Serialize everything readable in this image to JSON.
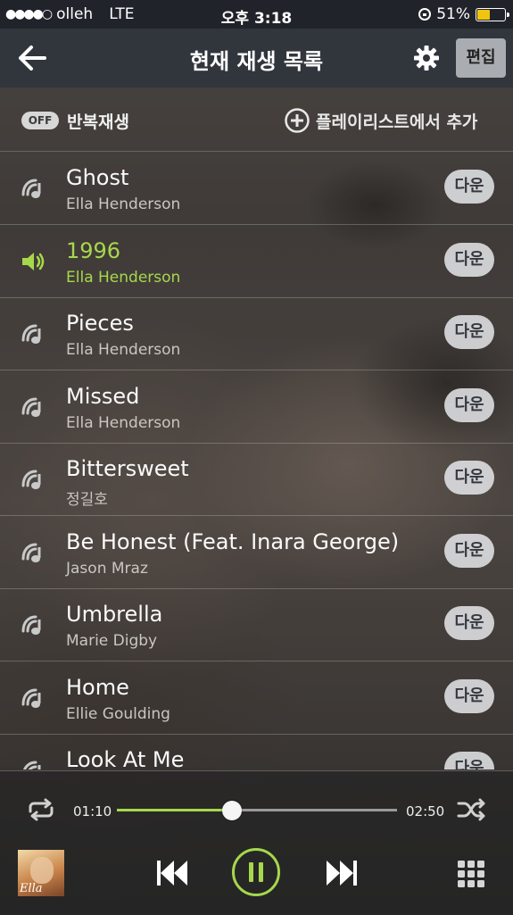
{
  "status_bar": {
    "carrier": "olleh",
    "network": "LTE",
    "time": "오후 3:18",
    "battery_text": "51%",
    "battery_level": 0.51
  },
  "nav": {
    "title": "현재 재생 목록",
    "edit_label": "편집"
  },
  "options": {
    "repeat_state": "OFF",
    "repeat_label": "반복재생",
    "add_label": "플레이리스트에서 추가"
  },
  "download_label": "다운",
  "tracks": [
    {
      "title": "Ghost",
      "artist": "Ella Henderson",
      "playing": false
    },
    {
      "title": "1996",
      "artist": "Ella Henderson",
      "playing": true
    },
    {
      "title": "Pieces",
      "artist": "Ella Henderson",
      "playing": false
    },
    {
      "title": "Missed",
      "artist": "Ella Henderson",
      "playing": false
    },
    {
      "title": "Bittersweet",
      "artist": "정길호",
      "playing": false
    },
    {
      "title": "Be Honest (Feat. Inara George)",
      "artist": "Jason Mraz",
      "playing": false
    },
    {
      "title": "Umbrella",
      "artist": "Marie Digby",
      "playing": false
    },
    {
      "title": "Home",
      "artist": "Ellie Goulding",
      "playing": false
    },
    {
      "title": "Look At Me",
      "artist": "",
      "playing": false
    }
  ],
  "player": {
    "current_time": "01:10",
    "total_time": "02:50",
    "progress": 0.41,
    "album_art_text": "Ella"
  },
  "colors": {
    "accent": "#a6d84b",
    "nav_bg": "#30343c",
    "status_bg": "#20232a"
  },
  "icons": {
    "back": "back-arrow-icon",
    "settings": "gear-icon",
    "add": "plus-circle-icon",
    "stream": "stream-note-icon",
    "playing": "speaker-icon",
    "repeat": "repeat-icon",
    "shuffle": "shuffle-icon",
    "prev": "previous-icon",
    "pause": "pause-icon",
    "next": "next-icon",
    "menu": "grid-menu-icon"
  }
}
